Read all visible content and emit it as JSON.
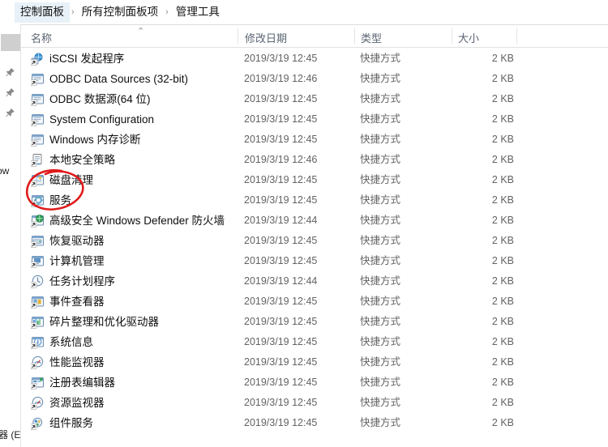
{
  "window": {
    "title": "管理工具"
  },
  "breadcrumb": {
    "separator": "›",
    "items": [
      {
        "label": "控制面板"
      },
      {
        "label": "所有控制面板项"
      },
      {
        "label": "管理工具"
      }
    ]
  },
  "sidebar": {
    "pinned_label_clipped": "ow",
    "bottom_label_clipped": "器 (E",
    "pins": [
      "pin-icon",
      "pin-icon",
      "pin-icon"
    ]
  },
  "columns": {
    "name": "名称",
    "date_modified": "修改日期",
    "type": "类型",
    "size": "大小",
    "sort_indicator": "⌃"
  },
  "files": [
    {
      "name": "iSCSI 发起程序",
      "date": "2019/3/19 12:45",
      "type": "快捷方式",
      "size": "2 KB",
      "icon": "shortcut-globe-icon"
    },
    {
      "name": "ODBC Data Sources (32-bit)",
      "date": "2019/3/19 12:46",
      "type": "快捷方式",
      "size": "2 KB",
      "icon": "shortcut-window-icon"
    },
    {
      "name": "ODBC 数据源(64 位)",
      "date": "2019/3/19 12:45",
      "type": "快捷方式",
      "size": "2 KB",
      "icon": "shortcut-window-icon"
    },
    {
      "name": "System Configuration",
      "date": "2019/3/19 12:45",
      "type": "快捷方式",
      "size": "2 KB",
      "icon": "shortcut-window-icon"
    },
    {
      "name": "Windows 内存诊断",
      "date": "2019/3/19 12:45",
      "type": "快捷方式",
      "size": "2 KB",
      "icon": "shortcut-window-icon"
    },
    {
      "name": "本地安全策略",
      "date": "2019/3/19 12:46",
      "type": "快捷方式",
      "size": "2 KB",
      "icon": "shortcut-doc-icon"
    },
    {
      "name": "磁盘清理",
      "date": "2019/3/19 12:45",
      "type": "快捷方式",
      "size": "2 KB",
      "icon": "shortcut-disk-icon"
    },
    {
      "name": "服务",
      "date": "2019/3/19 12:45",
      "type": "快捷方式",
      "size": "2 KB",
      "icon": "shortcut-gear-icon"
    },
    {
      "name": "高级安全 Windows Defender 防火墙",
      "date": "2019/3/19 12:44",
      "type": "快捷方式",
      "size": "2 KB",
      "icon": "shortcut-shield-icon"
    },
    {
      "name": "恢复驱动器",
      "date": "2019/3/19 12:45",
      "type": "快捷方式",
      "size": "2 KB",
      "icon": "shortcut-drive-icon"
    },
    {
      "name": "计算机管理",
      "date": "2019/3/19 12:45",
      "type": "快捷方式",
      "size": "2 KB",
      "icon": "shortcut-computer-icon"
    },
    {
      "name": "任务计划程序",
      "date": "2019/3/19 12:44",
      "type": "快捷方式",
      "size": "2 KB",
      "icon": "shortcut-clock-icon"
    },
    {
      "name": "事件查看器",
      "date": "2019/3/19 12:45",
      "type": "快捷方式",
      "size": "2 KB",
      "icon": "shortcut-event-icon"
    },
    {
      "name": "碎片整理和优化驱动器",
      "date": "2019/3/19 12:45",
      "type": "快捷方式",
      "size": "2 KB",
      "icon": "shortcut-defrag-icon"
    },
    {
      "name": "系统信息",
      "date": "2019/3/19 12:45",
      "type": "快捷方式",
      "size": "2 KB",
      "icon": "shortcut-info-icon"
    },
    {
      "name": "性能监视器",
      "date": "2019/3/19 12:45",
      "type": "快捷方式",
      "size": "2 KB",
      "icon": "shortcut-meter-icon"
    },
    {
      "name": "注册表编辑器",
      "date": "2019/3/19 12:45",
      "type": "快捷方式",
      "size": "2 KB",
      "icon": "shortcut-registry-icon"
    },
    {
      "name": "资源监视器",
      "date": "2019/3/19 12:45",
      "type": "快捷方式",
      "size": "2 KB",
      "icon": "shortcut-meter-icon"
    },
    {
      "name": "组件服务",
      "date": "2019/3/19 12:45",
      "type": "快捷方式",
      "size": "2 KB",
      "icon": "shortcut-components-icon"
    }
  ],
  "annotation": {
    "shape": "hand-drawn-red-ellipse",
    "targets_row_name": "服务",
    "color": "#e01b1b"
  }
}
